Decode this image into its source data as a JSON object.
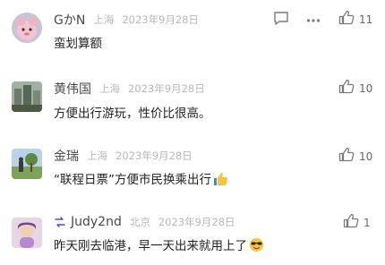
{
  "comments": [
    {
      "user": "GかN",
      "location": "上海",
      "date": "2023年9月28日",
      "text": "蛮划算额",
      "likes": "11",
      "avatar_icon": "pink-character-avatar",
      "actions": {
        "reply_icon": "comment-bubble-icon",
        "more_icon": "more-dots-icon"
      }
    },
    {
      "user": "黄伟国",
      "location": "上海",
      "date": "2023年9月28日",
      "text": "方便出行游玩，性价比很高。",
      "likes": "10",
      "avatar_icon": "city-building-avatar"
    },
    {
      "user": "金瑞",
      "location": "上海",
      "date": "2023年9月28日",
      "text": "“联程日票”方便市民换乘出行",
      "text_emoji": "thumbs-up-emoji",
      "likes": "10",
      "avatar_icon": "park-scene-avatar"
    },
    {
      "user": "Judy2nd",
      "location": "北京",
      "date": "2023年9月28日",
      "text": "昨天刚去临港，早一天出来就用上了",
      "text_emoji": "sunglasses-emoji",
      "likes": "1",
      "avatar_icon": "cartoon-girl-avatar",
      "badge_icon": "member-badge-icon"
    }
  ],
  "colors": {
    "username": "#4a4a4a",
    "meta": "#b9b9b9",
    "text": "#222222",
    "icon": "#7a7a7a"
  }
}
